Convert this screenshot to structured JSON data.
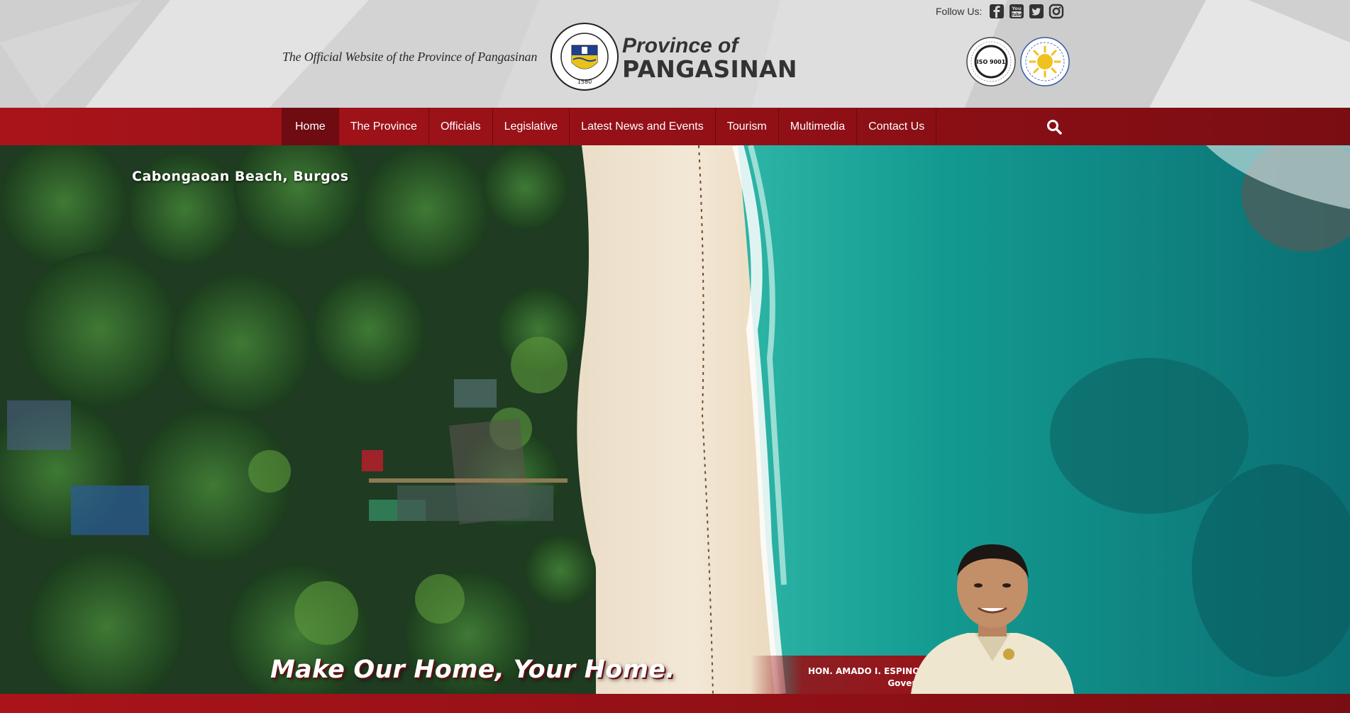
{
  "header": {
    "tagline": "The Official Website of the Province of Pangasinan",
    "brand_top": "Province of",
    "brand_bottom": "PANGASINAN",
    "seal_text": "PROVINCE OF PANGASINAN",
    "seal_year": "1580",
    "follow_label": "Follow Us:",
    "social_icons": [
      "facebook-icon",
      "youtube-icon",
      "twitter-icon",
      "instagram-icon"
    ],
    "badges": {
      "iso_center": "ISO 9001",
      "iso_ring": "CERTIFIED BY · SOCOTEC Certification International",
      "transparency_ring": "PHILIPPINE · TRANSPARENCY · SEAL"
    }
  },
  "nav": {
    "items": [
      {
        "label": "Home"
      },
      {
        "label": "The Province"
      },
      {
        "label": "Officials"
      },
      {
        "label": "Legislative"
      },
      {
        "label": "Latest News and Events"
      },
      {
        "label": "Tourism"
      },
      {
        "label": "Multimedia"
      },
      {
        "label": "Contact Us"
      }
    ],
    "search_icon": "search-icon"
  },
  "hero": {
    "caption": "Cabongaoan Beach, Burgos",
    "slogan": "Make Our Home, Your Home.",
    "governor_name": "HON. AMADO I. ESPINO III",
    "governor_title": "Governor"
  },
  "colors": {
    "nav_red": "#8f1016",
    "active_tab": "#6f0c11",
    "header_bg": "#d9d9d9",
    "sea": "#1aa39a"
  }
}
